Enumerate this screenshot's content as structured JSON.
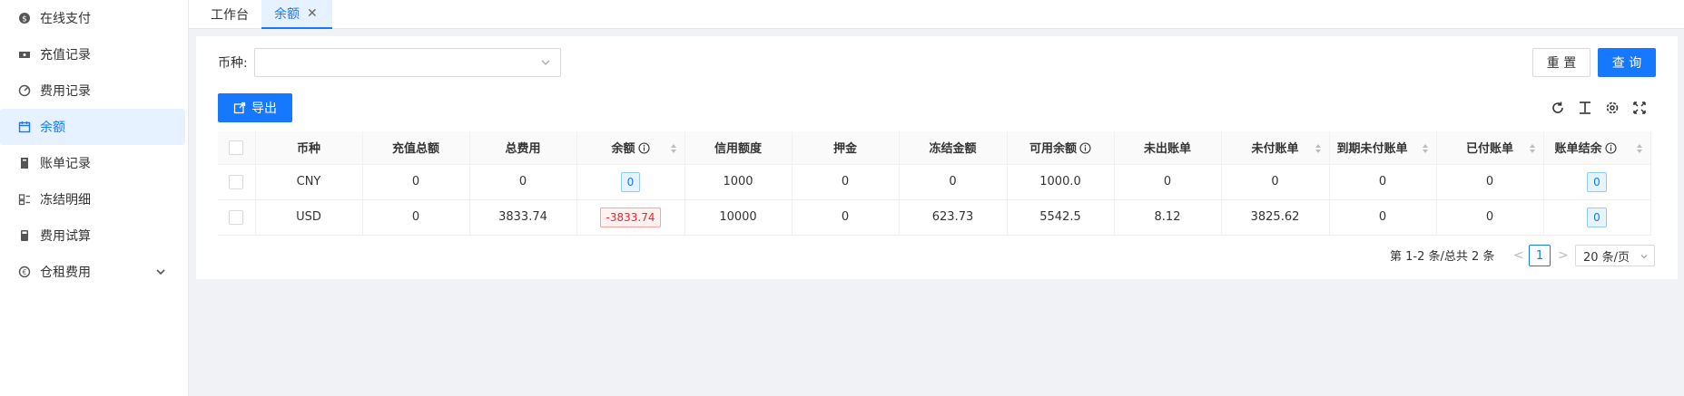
{
  "sidebar": {
    "items": [
      {
        "label": "在线支付",
        "icon": "payment-icon"
      },
      {
        "label": "充值记录",
        "icon": "ticket-icon"
      },
      {
        "label": "费用记录",
        "icon": "fee-record-icon"
      },
      {
        "label": "余额",
        "icon": "calendar-icon",
        "active": true
      },
      {
        "label": "账单记录",
        "icon": "bill-icon"
      },
      {
        "label": "冻结明细",
        "icon": "freeze-detail-icon"
      },
      {
        "label": "费用试算",
        "icon": "calculator-icon"
      },
      {
        "label": "仓租费用",
        "icon": "warehouse-fee-icon"
      }
    ]
  },
  "tabs": [
    {
      "label": "工作台"
    },
    {
      "label": "余额",
      "active": true,
      "close": "✕"
    }
  ],
  "filter": {
    "currency_label": "币种:",
    "currency_value": "",
    "reset_label": "重 置",
    "search_label": "查 询"
  },
  "toolbar": {
    "export_label": "导出"
  },
  "table": {
    "headers": [
      "币种",
      "充值总额",
      "总费用",
      "余额",
      "信用额度",
      "押金",
      "冻结金额",
      "可用余额",
      "未出账单",
      "未付账单",
      "到期未付账单",
      "已付账单",
      "账单结余"
    ],
    "rows": [
      [
        "CNY",
        "0",
        "0",
        "0",
        "1000",
        "0",
        "0",
        "1000.0",
        "0",
        "0",
        "0",
        "0",
        "0"
      ],
      [
        "USD",
        "0",
        "3833.74",
        "-3833.74",
        "10000",
        "0",
        "623.73",
        "5542.5",
        "8.12",
        "3825.62",
        "0",
        "0",
        "0"
      ]
    ]
  },
  "pagination": {
    "summary": "第 1-2 条/总共 2 条",
    "prev": "<",
    "current": "1",
    "next": ">",
    "page_size": "20 条/页"
  },
  "colors": {
    "primary": "#1677ff",
    "negative": "#f5222d"
  }
}
